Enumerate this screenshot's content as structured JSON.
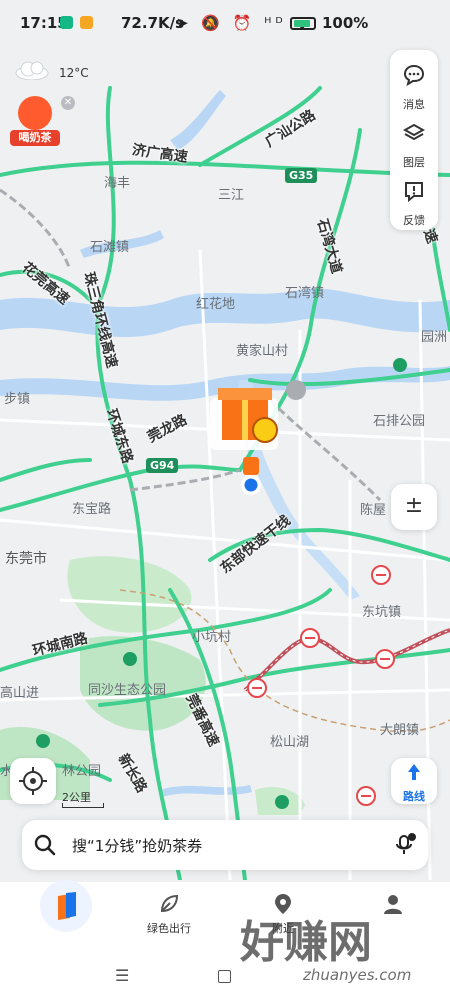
{
  "status_bar": {
    "time": "17:15",
    "network_speed": "72.7K/s",
    "icons_text": "➤ 🔕 ⏰ ᴴᴰ ᯤ",
    "battery": "100%"
  },
  "weather": {
    "temp": "12°C"
  },
  "promo": {
    "label": "喝奶茶"
  },
  "right_panel": {
    "items": [
      {
        "label": "消息",
        "icon": "message-icon"
      },
      {
        "label": "图层",
        "icon": "layers-icon"
      },
      {
        "label": "反馈",
        "icon": "feedback-icon"
      }
    ]
  },
  "map": {
    "place_labels": [
      "海丰",
      "三江",
      "石滩镇",
      "红花地",
      "石湾镇",
      "黄家山村",
      "园洲",
      "步镇",
      "石排公园",
      "东宝路",
      "陈屋",
      "东莞市",
      "东坑镇",
      "小坑村",
      "同沙生态公园",
      "高山进",
      "松山湖",
      "大朗镇",
      "水",
      "林公园"
    ],
    "road_labels": [
      "广汕公路",
      "济广高速",
      "石湾大道",
      "花莞高速",
      "珠三角环线高速",
      "环城东路",
      "莞龙路",
      "东部快速干线",
      "环城南路",
      "莞番高速",
      "新长路",
      "速"
    ],
    "shields": [
      "G35",
      "G94"
    ]
  },
  "controls": {
    "zoom_label": "±",
    "scale_label": "2公里",
    "route_label": "路线"
  },
  "search": {
    "placeholder": "搜“1分钱”抢奶茶券"
  },
  "bottom_nav": {
    "items": [
      {
        "label": "",
        "icon": "home-logo-icon"
      },
      {
        "label": "绿色出行",
        "icon": "leaf-icon"
      },
      {
        "label": "附近",
        "icon": "location-pin-icon"
      },
      {
        "label": "",
        "icon": "profile-icon"
      }
    ]
  },
  "watermark": {
    "main": "好赚网",
    "sub": "zhuanyes.com"
  },
  "colors": {
    "highway": "#3fcf8e",
    "water": "#b9d7f5",
    "park": "#bfe6c4",
    "jam": "#c0505a",
    "accent": "#1a73e8"
  }
}
